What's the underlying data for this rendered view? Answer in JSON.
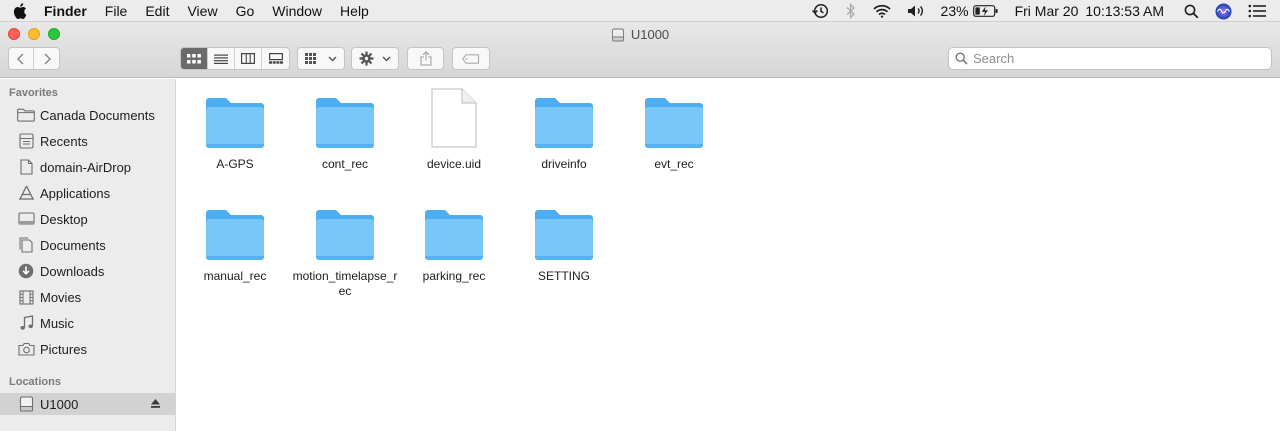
{
  "menubar": {
    "app_name": "Finder",
    "items": [
      "File",
      "Edit",
      "View",
      "Go",
      "Window",
      "Help"
    ],
    "battery_percent": "23%",
    "date": "Fri Mar 20",
    "time": "10:13:53 AM",
    "icons": [
      "time-machine-icon",
      "bluetooth-icon",
      "wifi-icon",
      "volume-icon",
      "battery-icon",
      "spotlight-icon",
      "siri-icon",
      "notification-center-icon"
    ]
  },
  "window": {
    "title": "U1000"
  },
  "search": {
    "placeholder": "Search"
  },
  "sidebar": {
    "favorites_header": "Favorites",
    "favorites": [
      {
        "label": "Canada Documents",
        "icon": "folder-icon"
      },
      {
        "label": "Recents",
        "icon": "recents-icon"
      },
      {
        "label": "domain-AirDrop",
        "icon": "document-icon"
      },
      {
        "label": "Applications",
        "icon": "applications-icon"
      },
      {
        "label": "Desktop",
        "icon": "desktop-icon"
      },
      {
        "label": "Documents",
        "icon": "documents-icon"
      },
      {
        "label": "Downloads",
        "icon": "downloads-icon"
      },
      {
        "label": "Movies",
        "icon": "movies-icon"
      },
      {
        "label": "Music",
        "icon": "music-icon"
      },
      {
        "label": "Pictures",
        "icon": "pictures-icon"
      }
    ],
    "locations_header": "Locations",
    "locations": [
      {
        "label": "U1000",
        "icon": "disk-icon",
        "selected": true
      }
    ]
  },
  "files": [
    {
      "name": "A-GPS",
      "type": "folder"
    },
    {
      "name": "cont_rec",
      "type": "folder"
    },
    {
      "name": "device.uid",
      "type": "document"
    },
    {
      "name": "driveinfo",
      "type": "folder"
    },
    {
      "name": "evt_rec",
      "type": "folder"
    },
    {
      "name": "manual_rec",
      "type": "folder"
    },
    {
      "name": "motion_timelapse_rec",
      "type": "folder"
    },
    {
      "name": "parking_rec",
      "type": "folder"
    },
    {
      "name": "SETTING",
      "type": "folder"
    }
  ],
  "colors": {
    "folder_light": "#79c7f9",
    "folder_dark": "#4eaef2",
    "sidebar_bg": "#ececec",
    "selection": "#d2d2d2"
  }
}
